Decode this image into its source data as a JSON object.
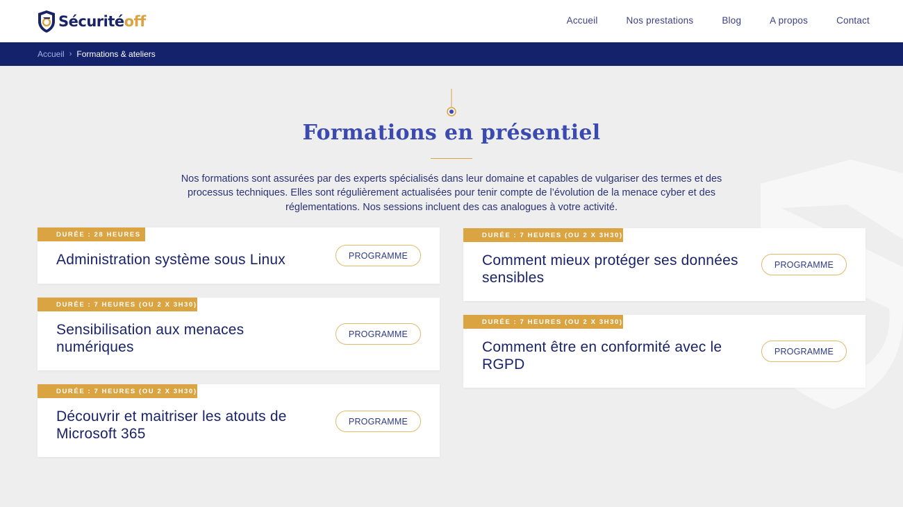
{
  "header": {
    "logo_text_main": "Sécurité",
    "logo_text_accent": "off",
    "nav": [
      "Accueil",
      "Nos prestations",
      "Blog",
      "A propos",
      "Contact"
    ]
  },
  "breadcrumb": {
    "home": "Accueil",
    "current": "Formations & ateliers"
  },
  "section": {
    "title": "Formations en présentiel",
    "intro": "Nos formations sont assurées par des experts spécialisés dans leur domaine et capables de vulgariser des termes et des processus techniques. Elles sont régulièrement actualisées pour tenir compte de l’évolution de la menace cyber et des réglementations. Nos sessions incluent des cas analogues à votre activité."
  },
  "courses": [
    {
      "duration": "DURÉE : 28 HEURES",
      "title": "Administration système sous Linux",
      "button": "PROGRAMME"
    },
    {
      "duration": "DURÉE : 7 HEURES (OU 2 X 3H30)",
      "title": "Sensibilisation aux menaces numériques",
      "button": "PROGRAMME"
    },
    {
      "duration": "DURÉE : 7 HEURES (OU 2 X 3H30)",
      "title": "Découvrir et maitriser les atouts de Microsoft 365",
      "button": "PROGRAMME"
    },
    {
      "duration": "DURÉE : 7 HEURES (OU 2 X 3H30)",
      "title": "Comment mieux protéger ses données sensibles",
      "button": "PROGRAMME"
    },
    {
      "duration": "DURÉE : 7 HEURES (OU 2 X 3H30)",
      "title": "Comment être en conformité avec le RGPD",
      "button": "PROGRAMME"
    }
  ],
  "colors": {
    "navy": "#1a2368",
    "breadcrumb_bar": "#14216b",
    "gold": "#d9a441",
    "title_blue": "#3a4ab0",
    "background": "#eeeeee"
  }
}
